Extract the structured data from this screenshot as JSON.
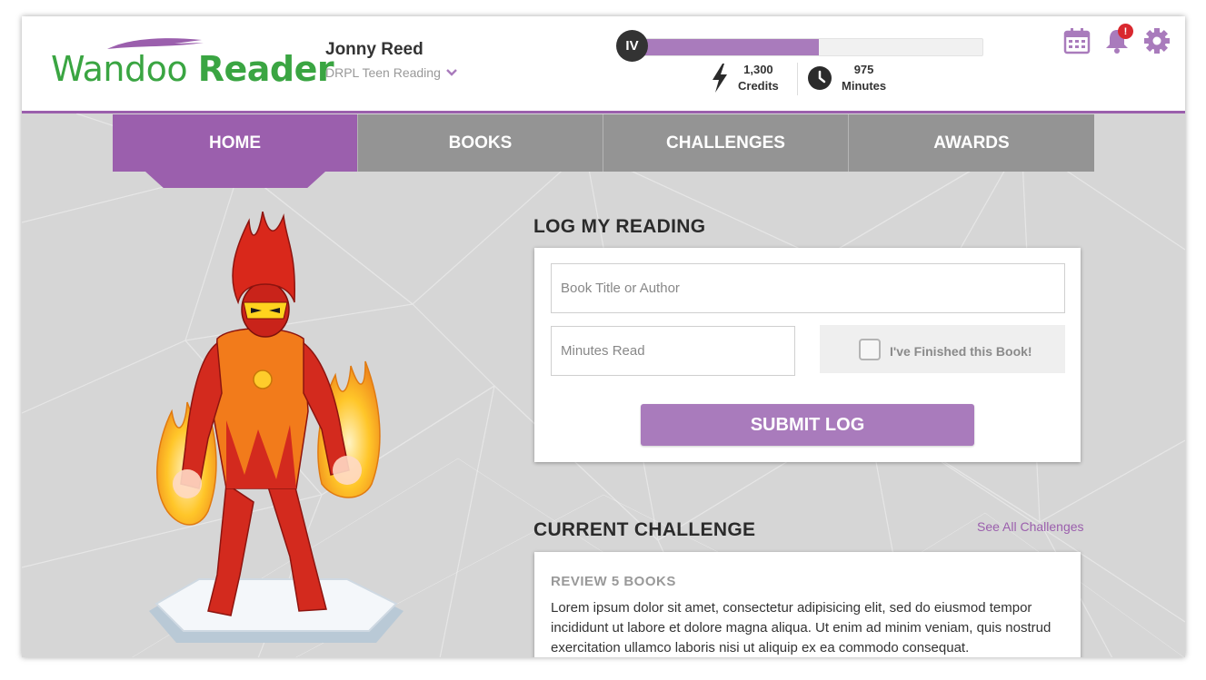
{
  "brand": {
    "word1": "Wandoo",
    "word2": "Reader",
    "swoosh_color": "#9b5fad",
    "text_color": "#3aa542"
  },
  "user": {
    "name": "Jonny Reed",
    "program": "DRPL Teen Reading"
  },
  "level": {
    "label": "IV",
    "progress_percent": 53
  },
  "stats": {
    "credits": {
      "value": "1,300",
      "label": "Credits",
      "icon": "lightning-icon"
    },
    "minutes": {
      "value": "975",
      "label": "Minutes",
      "icon": "clock-icon"
    }
  },
  "header_icons": {
    "calendar": "calendar-icon",
    "notifications": {
      "icon": "bell-icon",
      "badge": "!"
    },
    "settings": "gear-icon"
  },
  "nav": {
    "tabs": [
      "HOME",
      "BOOKS",
      "CHALLENGES",
      "AWARDS"
    ],
    "active": "HOME"
  },
  "log_reading": {
    "title": "LOG MY READING",
    "book_placeholder": "Book Title or Author",
    "minutes_placeholder": "Minutes Read",
    "finished_label": "I've Finished this Book!",
    "submit_label": "SUBMIT LOG"
  },
  "current_challenge": {
    "title": "CURRENT CHALLENGE",
    "see_all": "See All Challenges",
    "name": "REVIEW 5 BOOKS",
    "description": "Lorem ipsum dolor sit amet, consectetur adipisicing elit, sed do eiusmod tempor incididunt ut labore et dolore magna aliqua. Ut enim ad minim veniam, quis nostrud exercitation ullamco laboris nisi ut aliquip ex ea commodo consequat."
  },
  "colors": {
    "accent": "#9b5fad",
    "button": "#a97bbc",
    "nav_inactive": "#949494",
    "notify": "#d9282f"
  }
}
